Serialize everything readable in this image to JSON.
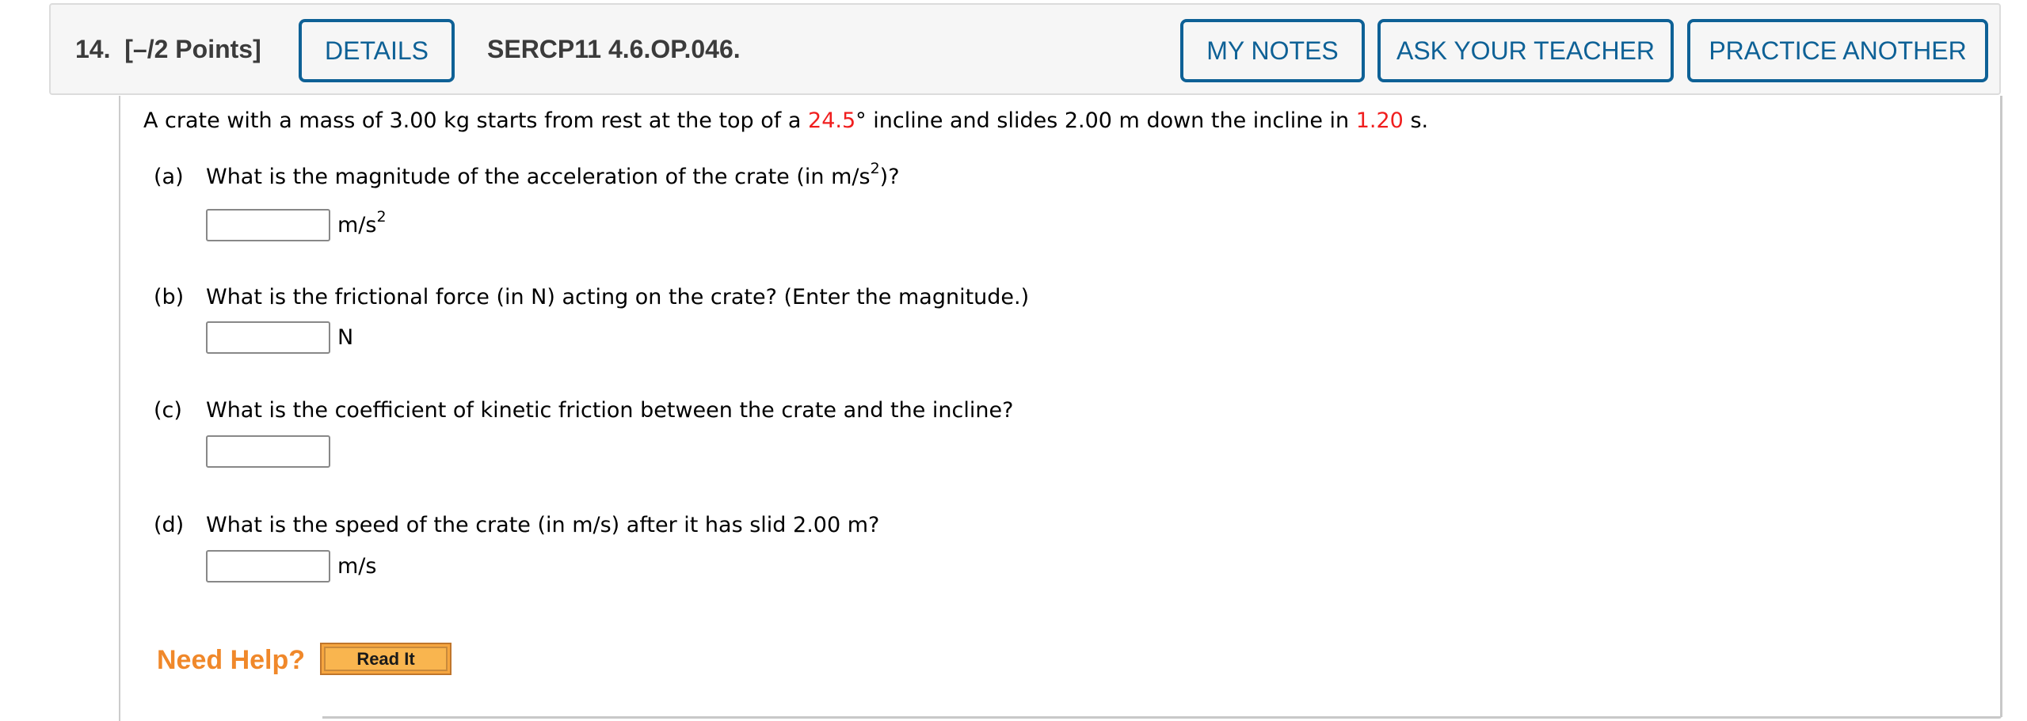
{
  "header": {
    "question_number": "14.",
    "points": "[–/2 Points]",
    "details_label": "DETAILS",
    "problem_code": "SERCP11 4.6.OP.046.",
    "my_notes_label": "MY NOTES",
    "ask_teacher_label": "ASK YOUR TEACHER",
    "practice_another_label": "PRACTICE ANOTHER"
  },
  "problem": {
    "intro_part1": "A crate with a mass of 3.00 kg starts from rest at the top of a ",
    "angle_value": "24.5",
    "intro_part2": "° incline and slides 2.00 m down the incline in ",
    "time_value": "1.20",
    "intro_part3": " s.",
    "highlight_color": "#f01e1e"
  },
  "parts": [
    {
      "label": "(a)",
      "question_pre": "What is the magnitude of the acceleration of the crate (in m/s",
      "question_sup": "2",
      "question_post": ")?",
      "unit": "m/s",
      "unit_sup": "2",
      "value": ""
    },
    {
      "label": "(b)",
      "question": "What is the frictional force (in N) acting on the crate? (Enter the magnitude.)",
      "unit": "N",
      "value": ""
    },
    {
      "label": "(c)",
      "question": "What is the coefficient of kinetic friction between the crate and the incline?",
      "unit": "",
      "value": ""
    },
    {
      "label": "(d)",
      "question": "What is the speed of the crate (in m/s) after it has slid 2.00 m?",
      "unit": "m/s",
      "value": ""
    }
  ],
  "help": {
    "need_help_label": "Need Help?",
    "read_it_label": "Read It"
  }
}
